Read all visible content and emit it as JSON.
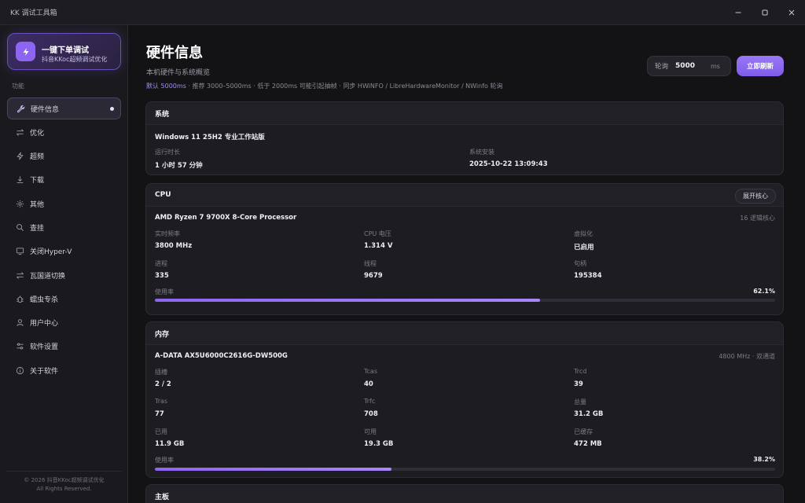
{
  "window": {
    "title": "KK 调试工具箱"
  },
  "sidebar": {
    "promo": {
      "title": "一键下单调试",
      "subtitle": "抖音KKoc超频调试优化"
    },
    "section_label": "功能",
    "items": [
      {
        "label": "硬件信息",
        "icon": "wrench-icon",
        "active": true
      },
      {
        "label": "优化",
        "icon": "tune-icon"
      },
      {
        "label": "超频",
        "icon": "bolt-icon"
      },
      {
        "label": "下载",
        "icon": "download-icon"
      },
      {
        "label": "其他",
        "icon": "sparkle-icon"
      },
      {
        "label": "查挂",
        "icon": "search-icon"
      },
      {
        "label": "关闭Hyper-V",
        "icon": "monitor-icon"
      },
      {
        "label": "瓦国道切换",
        "icon": "swap-icon"
      },
      {
        "label": "蠕虫专杀",
        "icon": "bug-icon"
      },
      {
        "label": "用户中心",
        "icon": "user-icon"
      },
      {
        "label": "软件设置",
        "icon": "sliders-icon"
      },
      {
        "label": "关于软件",
        "icon": "info-icon"
      }
    ],
    "footer": {
      "line1": "© 2026 抖音KKoc超频调试优化",
      "line2": "All Rights Reserved."
    }
  },
  "header": {
    "title": "硬件信息",
    "subtitle": "本机硬件与系统概览",
    "hint_highlight": "默认 5000ms",
    "hint_rest": " · 推荐 3000–5000ms · 低于 2000ms 可能引起抽帧 · 同步 HWiNFO / LibreHardwareMonitor / NWinfo 轮询",
    "interval": {
      "label": "轮询",
      "value": "5000",
      "unit": "ms"
    },
    "refresh_label": "立即刷新"
  },
  "system": {
    "title": "系统",
    "os": "Windows 11 25H2 专业工作站版",
    "uptime_label": "运行时长",
    "uptime": "1 小时 57 分钟",
    "install_label": "系统安装",
    "install": "2025-10-22 13:09:43"
  },
  "cpu": {
    "title": "CPU",
    "expand_label": "展开核心",
    "name": "AMD Ryzen 7 9700X 8-Core Processor",
    "threads": "16 逻辑核心",
    "fields": [
      {
        "label": "实时频率",
        "value": "3800 MHz"
      },
      {
        "label": "CPU 电压",
        "value": "1.314 V"
      },
      {
        "label": "虚拟化",
        "value": "已启用"
      },
      {
        "label": "进程",
        "value": "335"
      },
      {
        "label": "线程",
        "value": "9679"
      },
      {
        "label": "句柄",
        "value": "195384"
      }
    ],
    "usage_label": "使用率",
    "usage_text": "62.1%",
    "usage": 0.621
  },
  "memory": {
    "title": "内存",
    "name": "A-DATA AX5U6000C2616G-DW500G",
    "meta": "4800 MHz · 双通道",
    "fields": [
      {
        "label": "插槽",
        "value": "2 / 2"
      },
      {
        "label": "Tcas",
        "value": "40"
      },
      {
        "label": "Trcd",
        "value": "39"
      },
      {
        "label": "Tras",
        "value": "77"
      },
      {
        "label": "Trfc",
        "value": "708"
      },
      {
        "label": "总量",
        "value": "31.2 GB"
      },
      {
        "label": "已用",
        "value": "11.9 GB"
      },
      {
        "label": "可用",
        "value": "19.3 GB"
      },
      {
        "label": "已缓存",
        "value": "472 MB"
      }
    ],
    "usage_label": "使用率",
    "usage_text": "38.2%",
    "usage": 0.382
  },
  "motherboard": {
    "title": "主板"
  }
}
